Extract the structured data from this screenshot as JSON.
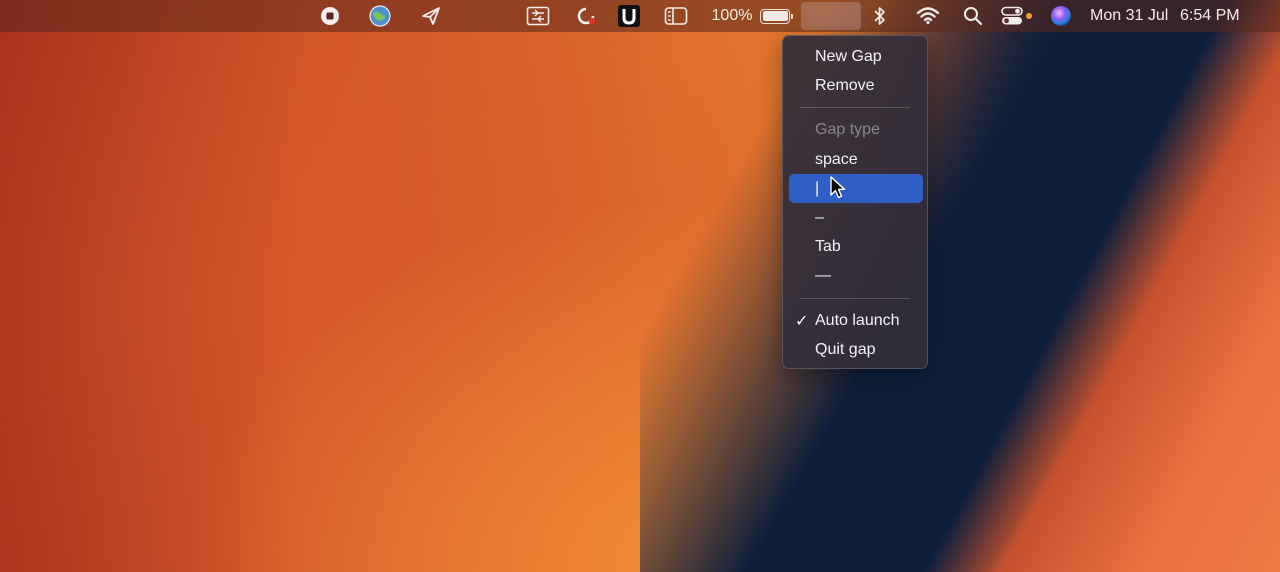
{
  "menubar": {
    "battery_percent": "100%",
    "battery_level": 100,
    "date": "Mon 31 Jul",
    "time": "6:54 PM",
    "icons": [
      "stop-record-icon",
      "globe-icon",
      "paper-plane-icon",
      "screen-capture-icon",
      "refresh-icon",
      "u-app-icon",
      "sidebar-icon",
      "battery-icon",
      "gap-icon",
      "bluetooth-icon",
      "wifi-icon",
      "search-icon",
      "control-center-icon",
      "siri-icon"
    ],
    "record_indicator_color": "#f2a233"
  },
  "menu": {
    "items": [
      {
        "label": "New Gap",
        "enabled": true
      },
      {
        "label": "Remove",
        "enabled": true
      },
      {
        "label": "Gap type",
        "enabled": false
      },
      {
        "label": "space",
        "enabled": true
      },
      {
        "label": "|",
        "enabled": true,
        "highlighted": true
      },
      {
        "label": "–",
        "enabled": true
      },
      {
        "label": "Tab",
        "enabled": true
      },
      {
        "label": "—",
        "enabled": true
      },
      {
        "label": "Auto launch",
        "enabled": true,
        "checked": true
      },
      {
        "label": "Quit gap",
        "enabled": true
      }
    ],
    "check_glyph": "✓",
    "highlight_color": "#2f5fc4"
  }
}
